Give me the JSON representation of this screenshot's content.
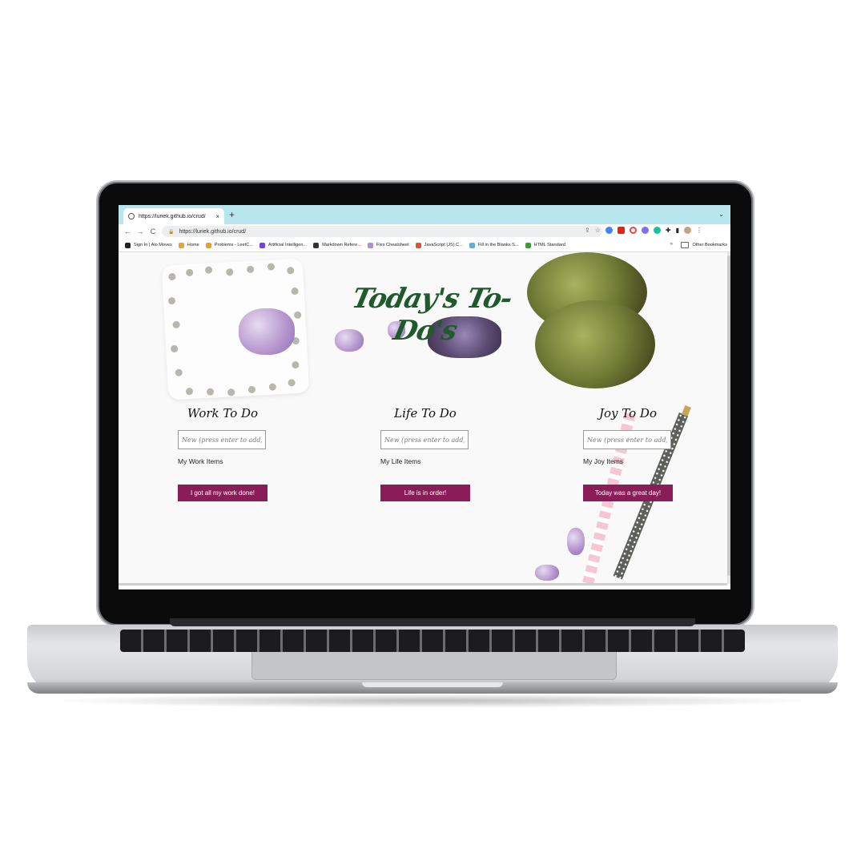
{
  "browser": {
    "tab_title": "https://luriek.github.io/crud/",
    "tab_close": "×",
    "new_tab": "+",
    "tab_menu": "⌄",
    "back": "←",
    "forward": "→",
    "reload": "C",
    "url": "https://luriek.github.io/crud/",
    "bookmarks": [
      {
        "label": "Sign In | Alo Moves",
        "color": "#222222"
      },
      {
        "label": "Home",
        "color": "#e8a33a"
      },
      {
        "label": "Problems - LeetC...",
        "color": "#f0a020"
      },
      {
        "label": "Artificial Intelligen...",
        "color": "#7b3fe4"
      },
      {
        "label": "Markdown Refere...",
        "color": "#333333"
      },
      {
        "label": "Flex Cheatsheet",
        "color": "#b08de0"
      },
      {
        "label": "JavaScript (JS) C...",
        "color": "#e5532d"
      },
      {
        "label": "Fill in the Blanks S...",
        "color": "#5ab0d8"
      },
      {
        "label": "HTML Standard",
        "color": "#3a9b3a"
      }
    ],
    "bookmarks_more": "»",
    "other_bookmarks": "Other Bookmarks"
  },
  "app": {
    "title": "Today's To-Do's",
    "columns": [
      {
        "heading": "Work To Do",
        "placeholder": "New (press enter to add)",
        "items_label": "My Work Items",
        "button": "I got all my work done!"
      },
      {
        "heading": "Life To Do",
        "placeholder": "New (press enter to add)",
        "items_label": "My Life Items",
        "button": "Life is in order!"
      },
      {
        "heading": "Joy To Do",
        "placeholder": "New (press enter to add)",
        "items_label": "My Joy Items",
        "button": "Today was a great day!"
      }
    ]
  },
  "colors": {
    "tab_bar": "#b8e6ef",
    "button": "#8a1c59",
    "title": "#1f5a2c"
  }
}
